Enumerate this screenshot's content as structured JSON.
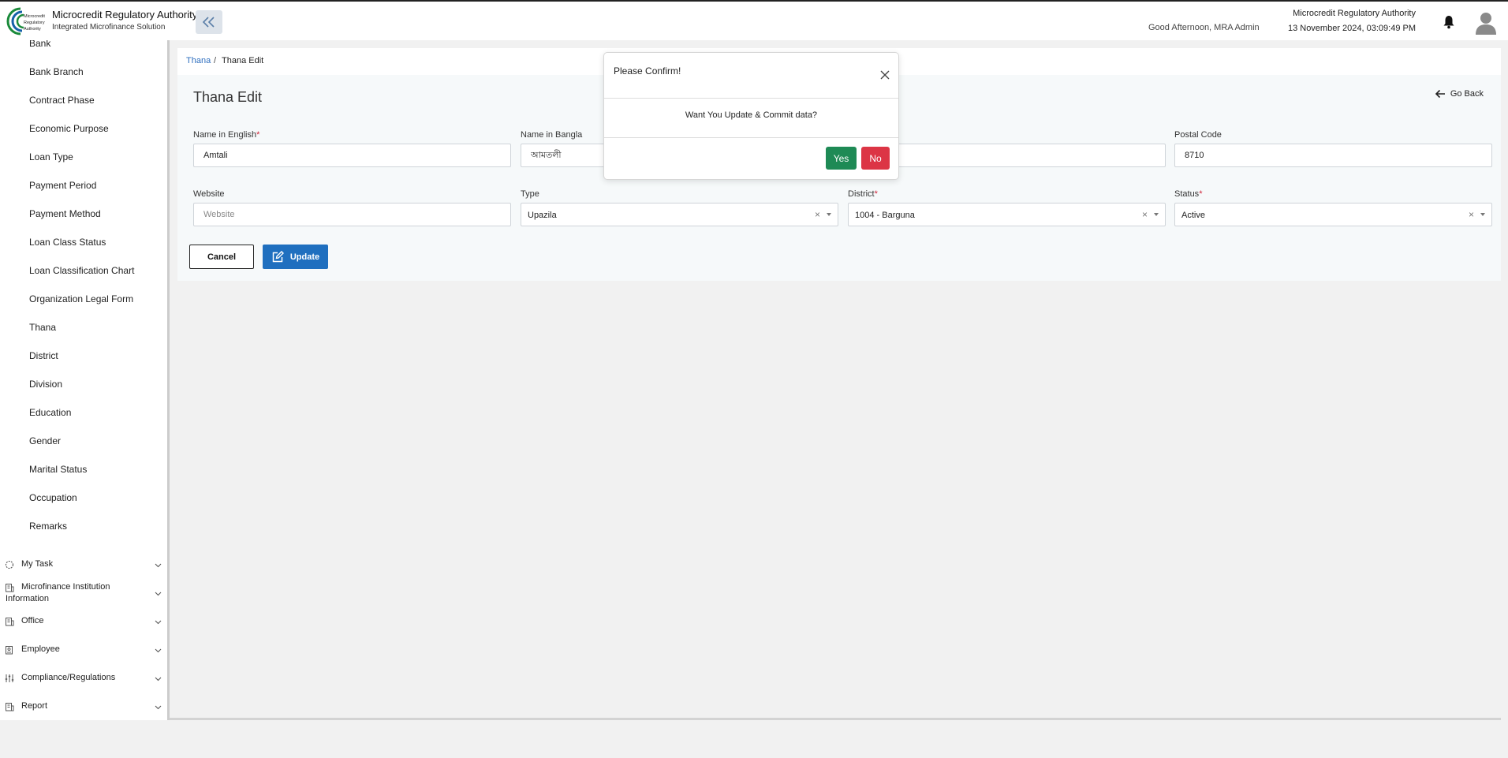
{
  "header": {
    "logo_text": [
      "Microcredit",
      "Regulatory",
      "Authority"
    ],
    "brand_title": "Microcredit Regulatory Authority",
    "brand_subtitle": "Integrated Microfinance Solution",
    "collapse_icon": "double-chevron-left-icon",
    "greeting": "Good Afternoon, MRA Admin",
    "org_name": "Microcredit Regulatory Authority",
    "datetime": "13 November 2024, 03:09:49 PM"
  },
  "sidebar": {
    "sub_items": [
      {
        "label": "Bank",
        "top": 0
      },
      {
        "label": "Bank Branch"
      },
      {
        "label": "Contract Phase"
      },
      {
        "label": "Economic Purpose"
      },
      {
        "label": "Loan Type"
      },
      {
        "label": "Payment Period"
      },
      {
        "label": "Payment Method"
      },
      {
        "label": "Loan Class Status"
      },
      {
        "label": "Loan Classification Chart"
      },
      {
        "label": "Organization Legal Form"
      },
      {
        "label": "Thana"
      },
      {
        "label": "District"
      },
      {
        "label": "Division"
      },
      {
        "label": "Education"
      },
      {
        "label": "Gender"
      },
      {
        "label": "Marital Status"
      },
      {
        "label": "Occupation"
      },
      {
        "label": "Remarks"
      }
    ],
    "menu": [
      {
        "label": "My Task",
        "icon": "circle-dash-icon"
      },
      {
        "label_line1": "Microfinance Institution",
        "label_line2": "Information",
        "icon": "building-icon"
      },
      {
        "label": "Office",
        "icon": "building-icon"
      },
      {
        "label": "Employee",
        "icon": "id-card-icon"
      },
      {
        "label": "Compliance/Regulations",
        "icon": "sliders-icon"
      },
      {
        "label": "Report",
        "icon": "report-icon"
      }
    ]
  },
  "breadcrumb": {
    "link": "Thana",
    "separator": "/",
    "current": "Thana Edit"
  },
  "page": {
    "title": "Thana Edit",
    "go_back": "Go Back"
  },
  "form": {
    "name_en": {
      "label": "Name in English",
      "required": "*",
      "value": "Amtali"
    },
    "name_bn": {
      "label": "Name in Bangla",
      "value": "আমতলী"
    },
    "postal_code": {
      "label": "Postal Code",
      "value": "8710"
    },
    "website": {
      "label": "Website",
      "value": "",
      "placeholder": "Website"
    },
    "type": {
      "label": "Type",
      "value": "Upazila"
    },
    "district": {
      "label": "District",
      "required": "*",
      "value": "1004 - Barguna"
    },
    "status": {
      "label": "Status",
      "required": "*",
      "value": "Active"
    },
    "clear_glyph": "×",
    "cancel_label": "Cancel",
    "update_label": "Update"
  },
  "modal": {
    "title": "Please Confirm!",
    "message": "Want You Update & Commit data?",
    "yes_label": "Yes",
    "no_label": "No"
  },
  "colors": {
    "link": "#2f6fbf",
    "primary": "#1f6fbf",
    "success": "#1e8a55",
    "danger": "#dc3545",
    "required": "#d0263a"
  }
}
